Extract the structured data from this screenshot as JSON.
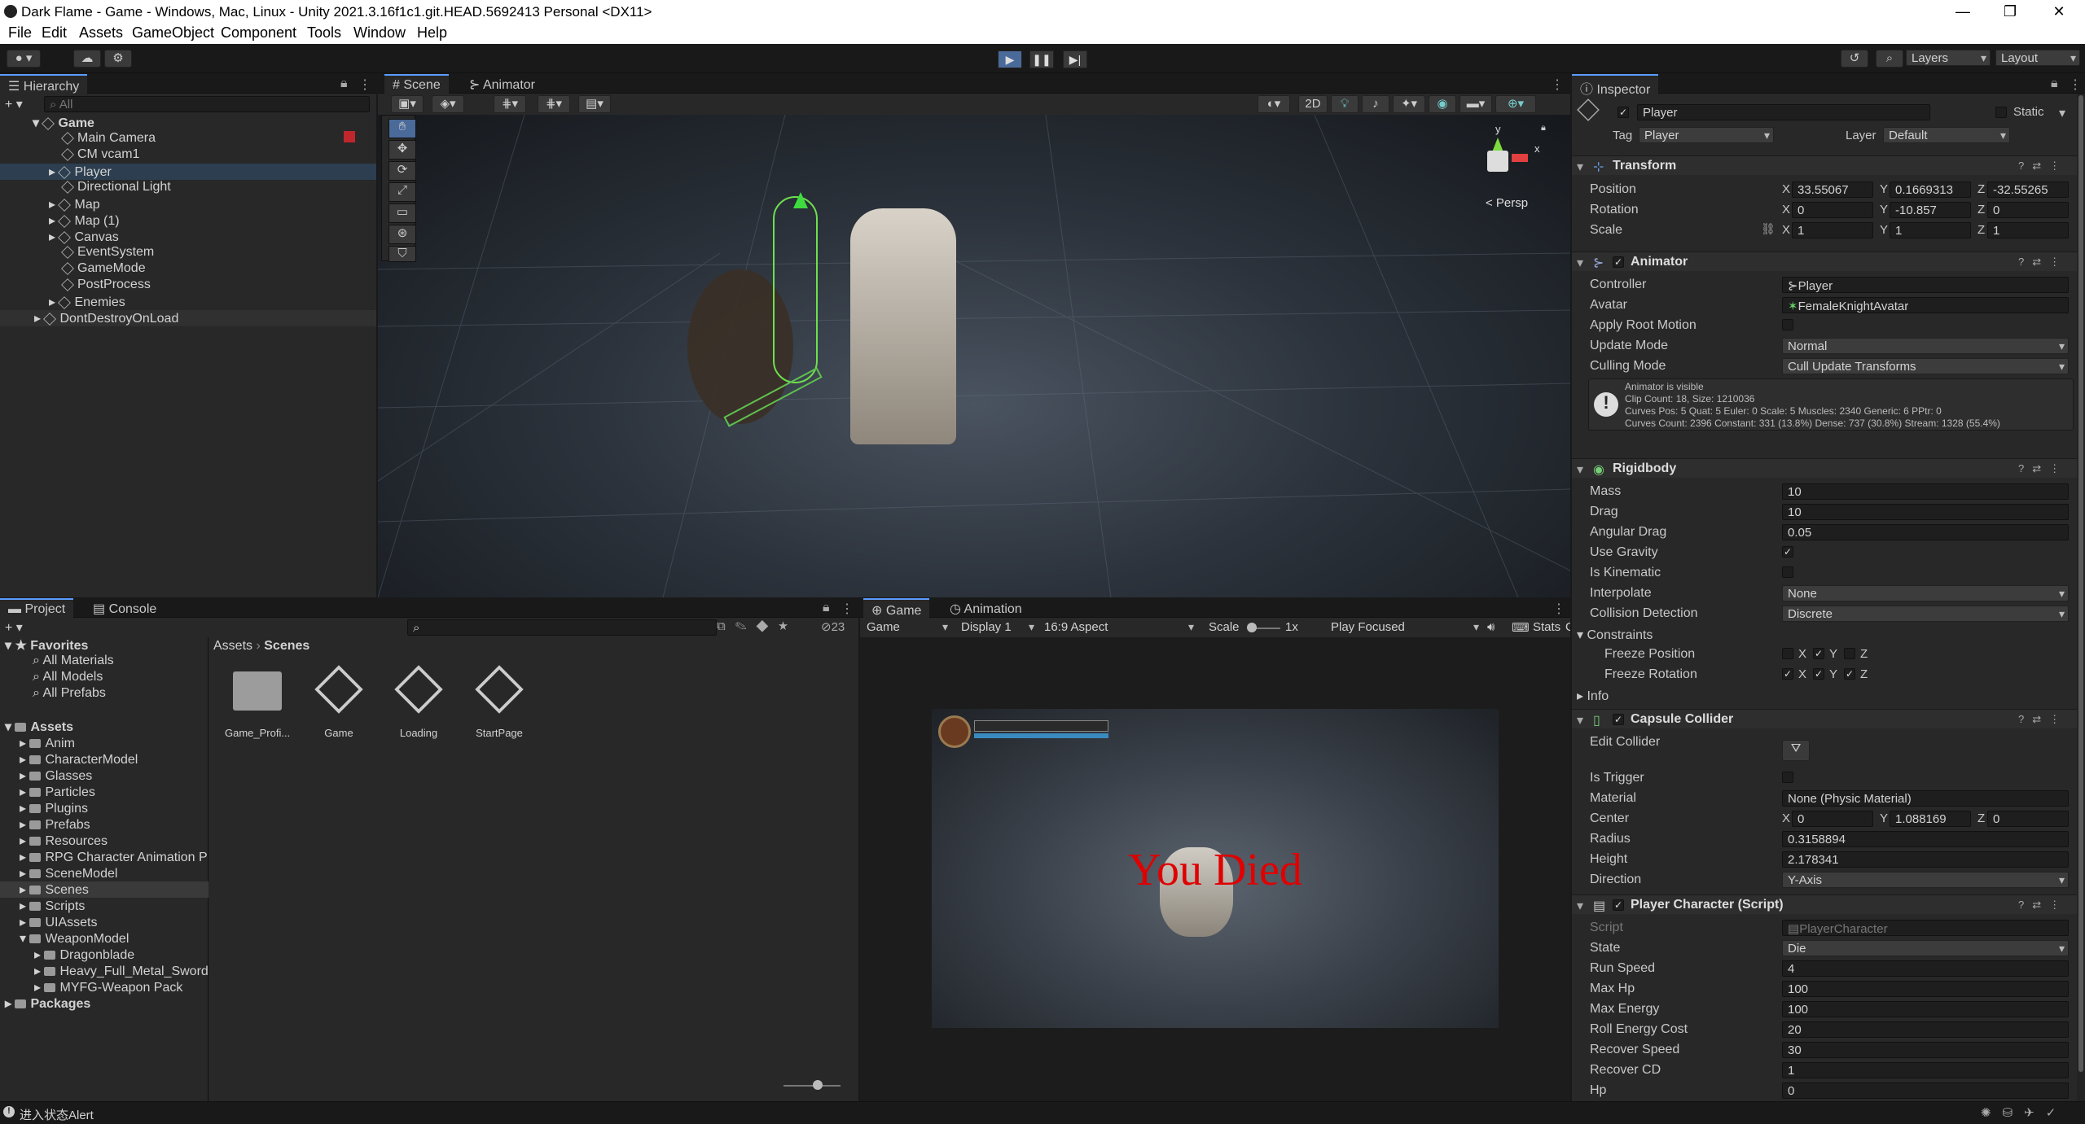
{
  "window": {
    "title": "Dark Flame - Game - Windows, Mac, Linux - Unity 2021.3.16f1c1.git.HEAD.5692413 Personal <DX11>"
  },
  "menu": [
    "File",
    "Edit",
    "Assets",
    "GameObject",
    "Component",
    "Tools",
    "Window",
    "Help"
  ],
  "toolbar": {
    "layers": "Layers",
    "layout": "Layout"
  },
  "hierarchy": {
    "tab": "Hierarchy",
    "search_placeholder": "All",
    "items": [
      {
        "label": "Game"
      },
      {
        "label": "Main Camera"
      },
      {
        "label": "CM vcam1"
      },
      {
        "label": "Player"
      },
      {
        "label": "Directional Light"
      },
      {
        "label": "Map"
      },
      {
        "label": "Map (1)"
      },
      {
        "label": "Canvas"
      },
      {
        "label": "EventSystem"
      },
      {
        "label": "GameMode"
      },
      {
        "label": "PostProcess"
      },
      {
        "label": "Enemies"
      },
      {
        "label": "DontDestroyOnLoad"
      }
    ]
  },
  "scene": {
    "tab_scene": "Scene",
    "tab_animator": "Animator",
    "btn_2d": "2D",
    "persp": "< Persp",
    "gizmo_y": "y",
    "gizmo_x": "x"
  },
  "project": {
    "tab_project": "Project",
    "tab_console": "Console",
    "hidden_count": "23",
    "favorites": {
      "label": "Favorites",
      "items": [
        "All Materials",
        "All Models",
        "All Prefabs"
      ]
    },
    "assets": {
      "label": "Assets",
      "items": [
        "Anim",
        "CharacterModel",
        "Glasses",
        "Particles",
        "Plugins",
        "Prefabs",
        "Resources",
        "RPG Character Animation P",
        "SceneModel",
        "Scenes",
        "Scripts",
        "UIAssets",
        "WeaponModel"
      ]
    },
    "weapon_children": [
      "Dragonblade",
      "Heavy_Full_Metal_Sword",
      "MYFG-Weapon Pack"
    ],
    "packages": "Packages",
    "breadcrumb": [
      "Assets",
      "Scenes"
    ],
    "files": [
      "Game_Profi...",
      "Game",
      "Loading",
      "StartPage"
    ]
  },
  "game": {
    "tab_game": "Game",
    "tab_animation": "Animation",
    "display_select": "Game",
    "display": "Display 1",
    "aspect": "16:9 Aspect",
    "scale_label": "Scale",
    "scale_value": "1x",
    "play_focused": "Play Focused",
    "stats": "Stats",
    "gizmos": "Gizmos",
    "death_text": "You Died"
  },
  "inspector": {
    "tab": "Inspector",
    "object_name": "Player",
    "static": "Static",
    "tag_label": "Tag",
    "tag": "Player",
    "layer_label": "Layer",
    "layer": "Default",
    "transform": {
      "title": "Transform",
      "position": "Position",
      "rotation": "Rotation",
      "scale": "Scale",
      "pos": [
        "33.55067",
        "0.1669313",
        "-32.55265"
      ],
      "rot": [
        "0",
        "-10.857",
        "0"
      ],
      "scl": [
        "1",
        "1",
        "1"
      ]
    },
    "animator": {
      "title": "Animator",
      "controller_label": "Controller",
      "controller": "Player",
      "avatar_label": "Avatar",
      "avatar": "FemaleKnightAvatar",
      "root_motion": "Apply Root Motion",
      "update_mode_label": "Update Mode",
      "update_mode": "Normal",
      "culling_label": "Culling Mode",
      "culling": "Cull Update Transforms",
      "info1": "Animator is visible",
      "info2": "Clip Count: 18, Size: 1210036",
      "info3": "Curves Pos: 5 Quat: 5 Euler: 0 Scale: 5 Muscles: 2340 Generic: 6 PPtr: 0",
      "info4": "Curves Count: 2396 Constant: 331 (13.8%) Dense: 737 (30.8%) Stream: 1328 (55.4%)"
    },
    "rigidbody": {
      "title": "Rigidbody",
      "mass_label": "Mass",
      "mass": "10",
      "drag_label": "Drag",
      "drag": "10",
      "adrag_label": "Angular Drag",
      "adrag": "0.05",
      "gravity": "Use Gravity",
      "kinematic": "Is Kinematic",
      "interp_label": "Interpolate",
      "interp": "None",
      "coll_label": "Collision Detection",
      "coll": "Discrete",
      "constraints": "Constraints",
      "freeze_pos": "Freeze Position",
      "freeze_rot": "Freeze Rotation",
      "info": "Info"
    },
    "capsule": {
      "title": "Capsule Collider",
      "edit": "Edit Collider",
      "trigger": "Is Trigger",
      "material_label": "Material",
      "material": "None (Physic Material)",
      "center_label": "Center",
      "center": [
        "0",
        "1.088169",
        "0"
      ],
      "radius_label": "Radius",
      "radius": "0.3158894",
      "height_label": "Height",
      "height": "2.178341",
      "dir_label": "Direction",
      "dir": "Y-Axis"
    },
    "player": {
      "title": "Player Character (Script)",
      "script_label": "Script",
      "script": "PlayerCharacter",
      "fields": [
        [
          "State",
          "Die"
        ],
        [
          "Run Speed",
          "4"
        ],
        [
          "Max Hp",
          "100"
        ],
        [
          "Max Energy",
          "100"
        ],
        [
          "Roll Energy Cost",
          "20"
        ],
        [
          "Recover Speed",
          "30"
        ],
        [
          "Recover CD",
          "1"
        ],
        [
          "Hp",
          "0"
        ]
      ]
    }
  },
  "status": {
    "text": "进入状态Alert"
  }
}
